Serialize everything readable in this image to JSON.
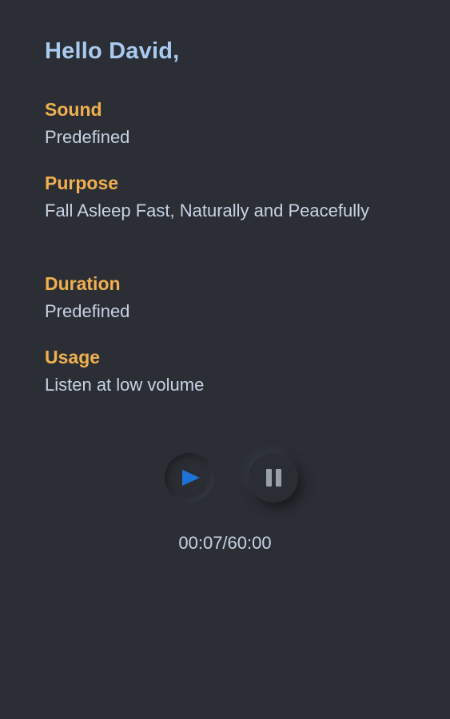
{
  "greeting": "Hello David,",
  "fields": {
    "sound": {
      "label": "Sound",
      "value": "Predefined"
    },
    "purpose": {
      "label": "Purpose",
      "value": "Fall Asleep Fast, Naturally and Peacefully"
    },
    "duration": {
      "label": "Duration",
      "value": "Predefined"
    },
    "usage": {
      "label": "Usage",
      "value": "Listen at low volume"
    }
  },
  "player": {
    "play_icon": "play-icon",
    "pause_icon": "pause-icon",
    "active_button": "play",
    "elapsed_time": "00:07/60:00"
  },
  "colors": {
    "background": "#2b2e35",
    "greeting": "#a9cbf1",
    "label": "#f1b04f",
    "value": "#c7d3e3",
    "play_accent": "#1e73d6"
  }
}
